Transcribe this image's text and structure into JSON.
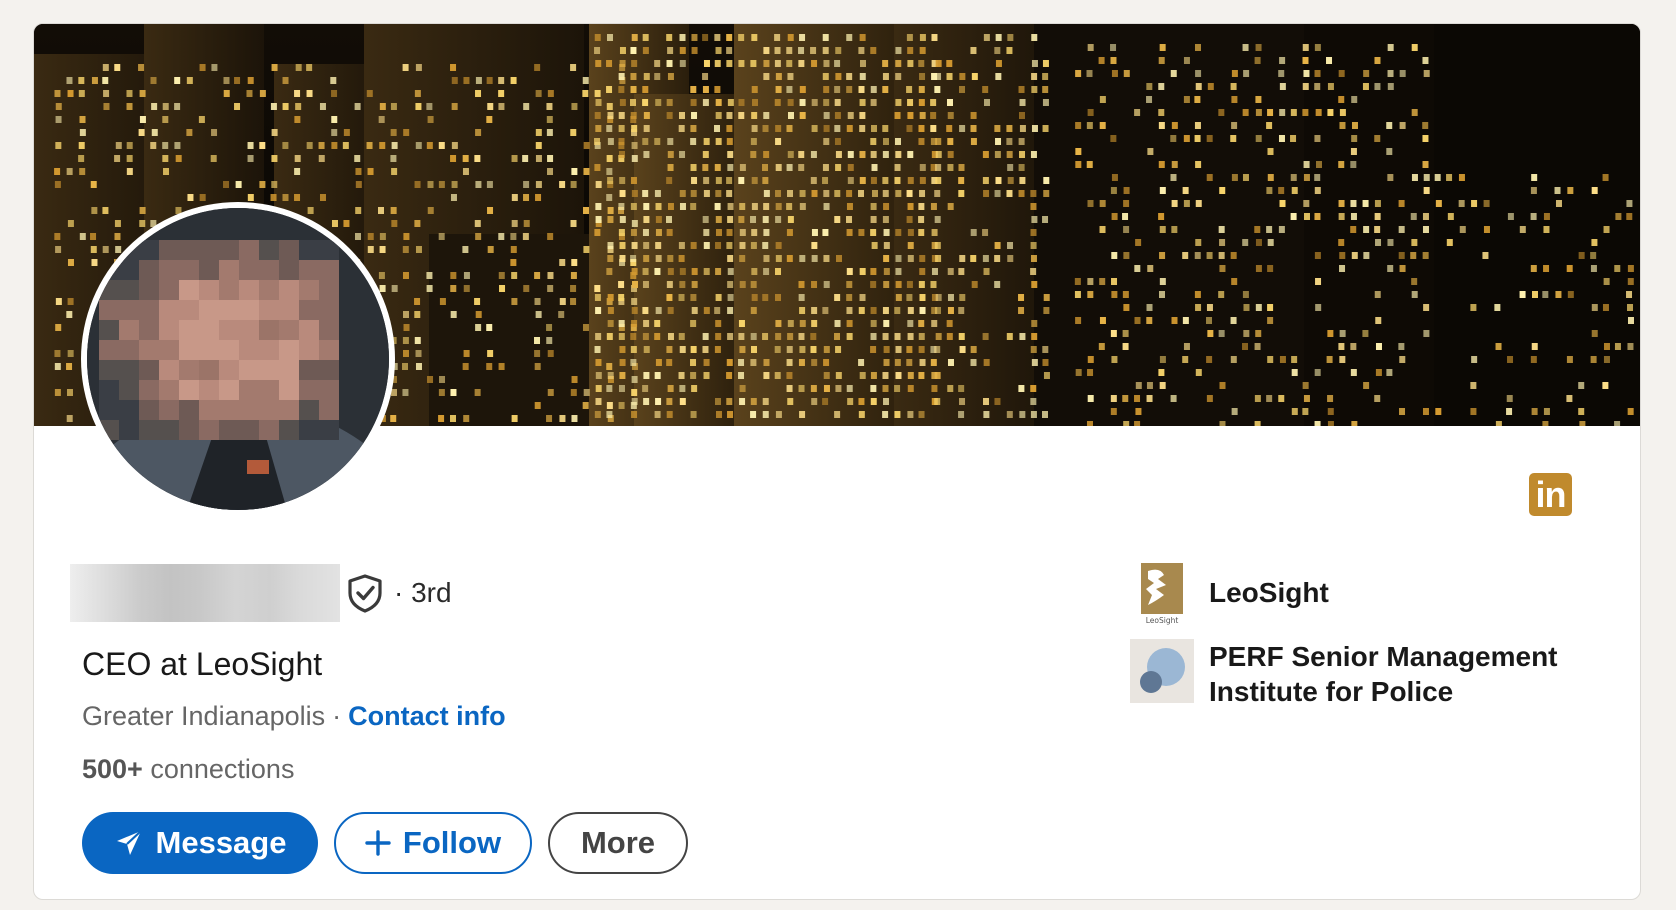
{
  "profile": {
    "degree": "· 3rd",
    "headline": "CEO at LeoSight",
    "location": "Greater Indianapolis",
    "separator": "·",
    "contact_label": "Contact info",
    "connections_count": "500+",
    "connections_label": "connections"
  },
  "actions": {
    "message_label": "Message",
    "follow_label": "Follow",
    "more_label": "More"
  },
  "orgs": [
    {
      "name": "LeoSight",
      "logo_text": "LeoSight",
      "icon": "leosight-logo"
    },
    {
      "name_line1": "PERF Senior Management",
      "name_line2": "Institute for Police",
      "icon": "perf-logo"
    }
  ],
  "icons": {
    "verify": "shield-check-icon",
    "linkedin": "linkedin-icon",
    "message": "paper-plane-icon",
    "follow": "plus-icon"
  },
  "linkedin_badge_text": "in",
  "colors": {
    "brand_blue": "#0a66c2",
    "linkedin_badge": "#c08a2d",
    "page_bg": "#f4f2ee"
  }
}
